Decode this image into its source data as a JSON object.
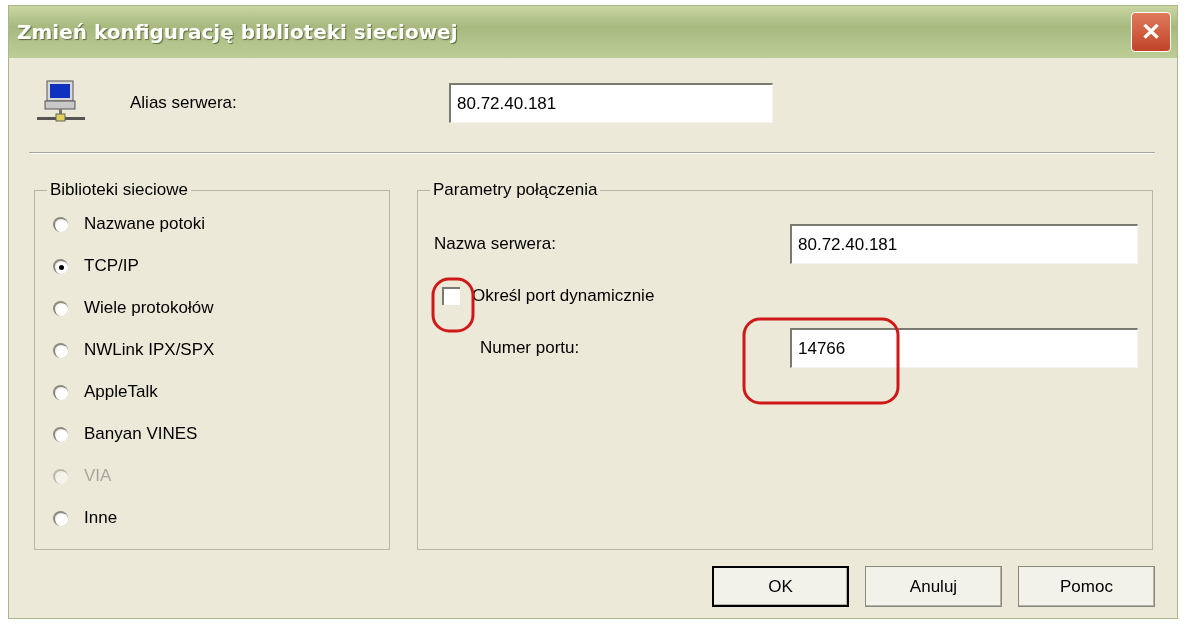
{
  "window": {
    "title": "Zmień konfigurację biblioteki sieciowej",
    "close_label": "✕"
  },
  "alias": {
    "label": "Alias serwera:",
    "value": "80.72.40.181"
  },
  "libraries": {
    "title": "Biblioteki sieciowe",
    "items": [
      {
        "label": "Nazwane potoki",
        "selected": false,
        "disabled": false
      },
      {
        "label": "TCP/IP",
        "selected": true,
        "disabled": false
      },
      {
        "label": "Wiele protokołów",
        "selected": false,
        "disabled": false
      },
      {
        "label": "NWLink IPX/SPX",
        "selected": false,
        "disabled": false
      },
      {
        "label": "AppleTalk",
        "selected": false,
        "disabled": false
      },
      {
        "label": "Banyan VINES",
        "selected": false,
        "disabled": false
      },
      {
        "label": "VIA",
        "selected": false,
        "disabled": true
      },
      {
        "label": "Inne",
        "selected": false,
        "disabled": false
      }
    ]
  },
  "parameters": {
    "title": "Parametry połączenia",
    "server_name": {
      "label": "Nazwa serwera:",
      "value": "80.72.40.181"
    },
    "dynamic_port": {
      "label": "Określ port dynamicznie",
      "checked": false
    },
    "port": {
      "label": "Numer portu:",
      "value": "14766"
    }
  },
  "buttons": [
    {
      "label": "OK",
      "default": true
    },
    {
      "label": "Anuluj",
      "default": false
    },
    {
      "label": "Pomoc",
      "default": false
    }
  ]
}
